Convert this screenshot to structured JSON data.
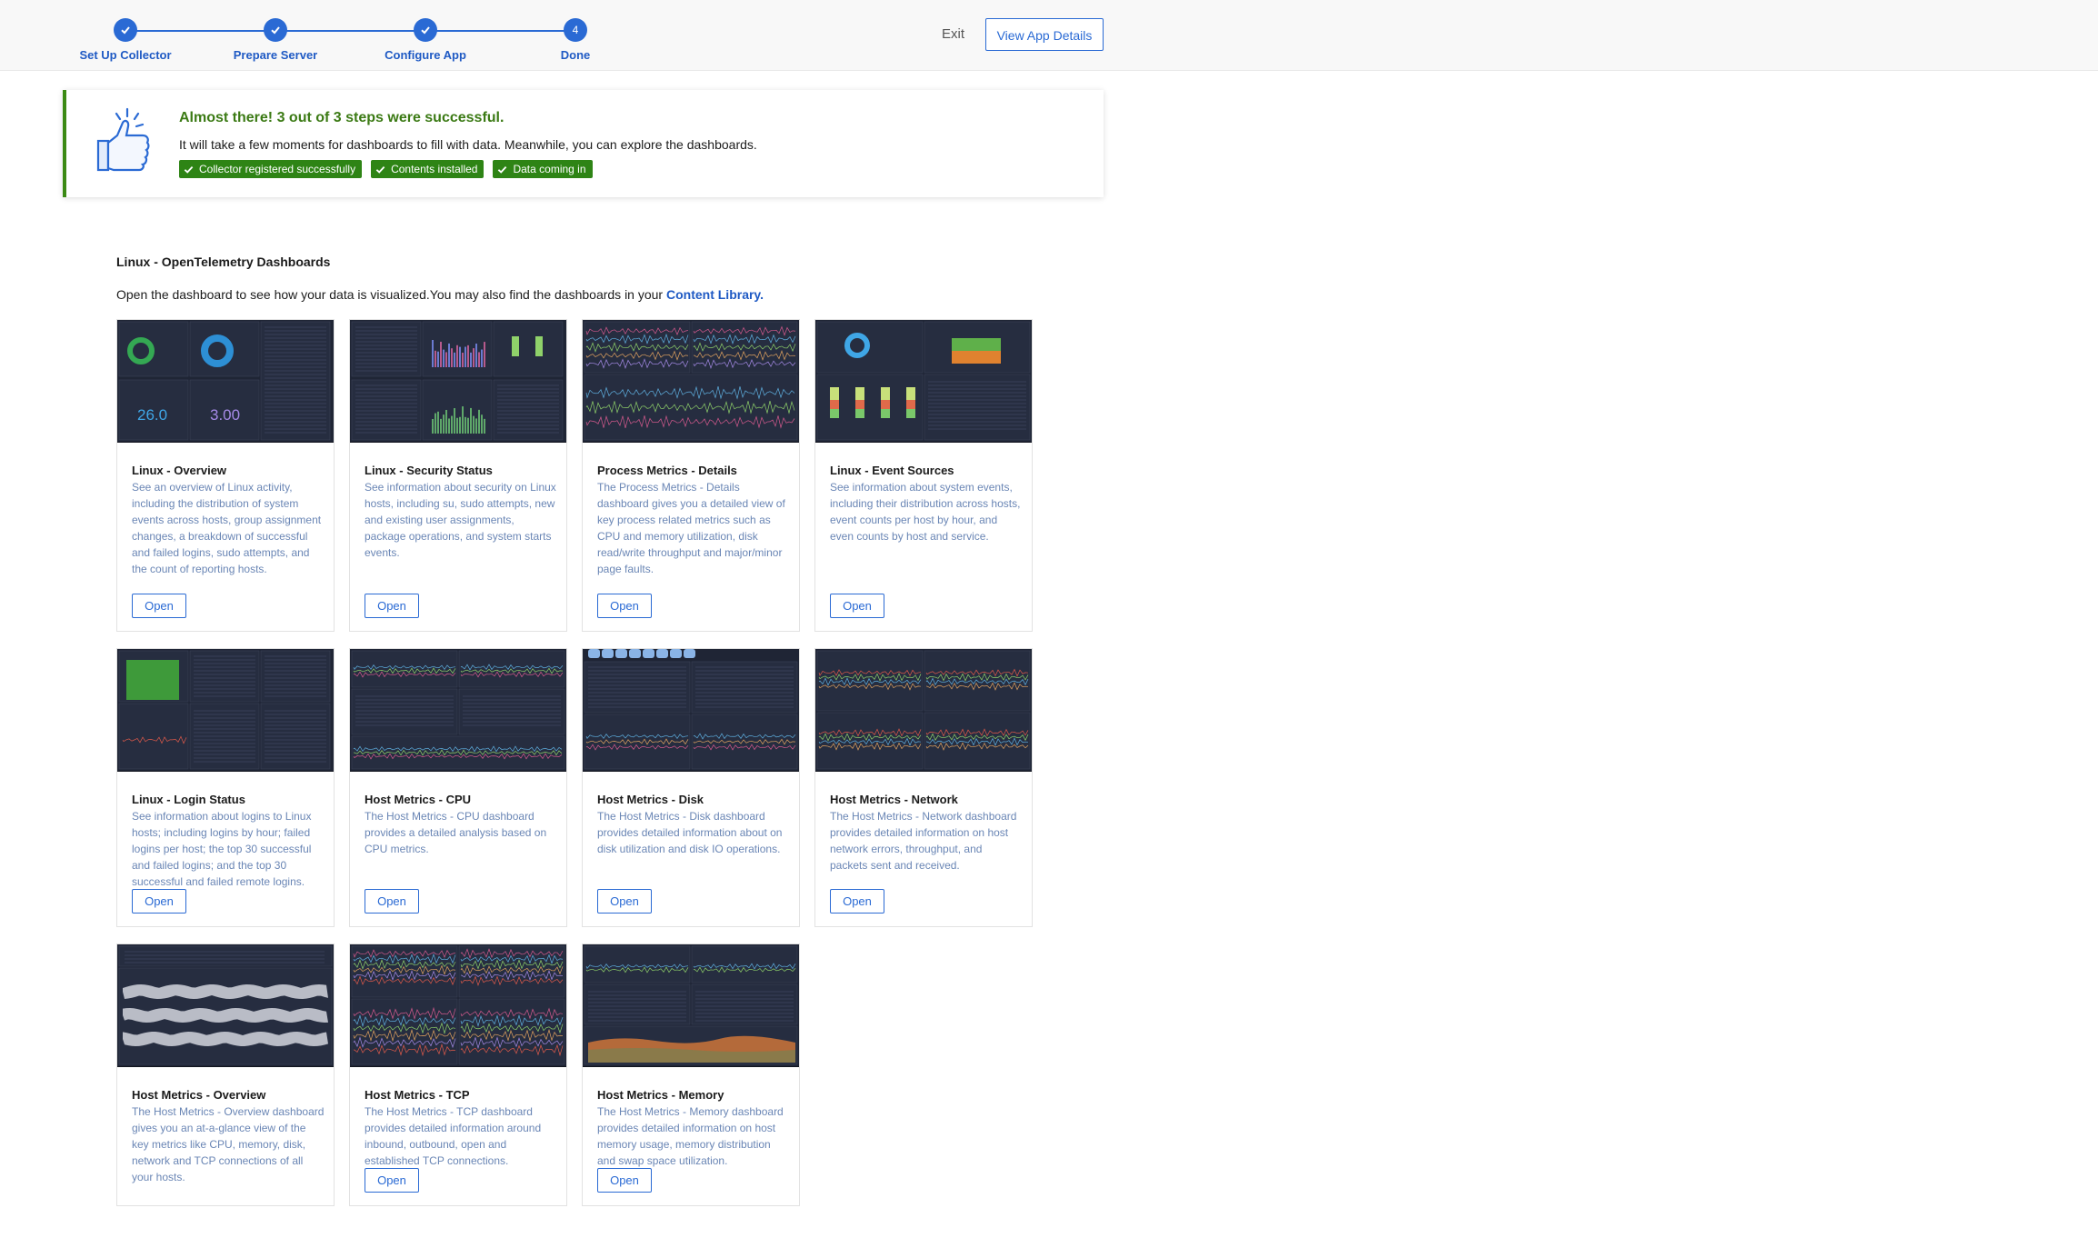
{
  "stepper": {
    "steps": [
      {
        "label": "Set Up Collector",
        "state": "complete"
      },
      {
        "label": "Prepare Server",
        "state": "complete"
      },
      {
        "label": "Configure App",
        "state": "complete"
      },
      {
        "label": "Done",
        "number": "4",
        "state": "current"
      }
    ]
  },
  "header": {
    "exit_label": "Exit",
    "view_app_label": "View App Details"
  },
  "banner": {
    "title": "Almost there! 3 out of 3 steps were successful.",
    "text": "It will take a few moments for dashboards to fill with data. Meanwhile, you can explore the dashboards.",
    "tags": [
      "Collector registered successfully",
      "Contents installed",
      "Data coming in"
    ],
    "icon": "thumbs-up-icon",
    "success_color": "#2e8415"
  },
  "section": {
    "title": "Linux - OpenTelemetry Dashboards",
    "desc_text": "Open the dashboard to see how your data is visualized.You may also find the dashboards in your ",
    "desc_link": "Content Library."
  },
  "accent_color": "#2a6ad4",
  "cards": [
    {
      "title": "Linux - Overview",
      "desc": "See an overview of Linux activity, including the distribution of system events across hosts, group assignment changes, a breakdown of successful and failed logins, sudo attempts, and the count of reporting hosts.",
      "open": "Open",
      "preview_values": [
        "26.0",
        "3.00"
      ]
    },
    {
      "title": "Linux - Security Status",
      "desc": "See information about security on Linux hosts, including su, sudo attempts, new and existing user assignments, package operations, and system starts events.",
      "open": "Open"
    },
    {
      "title": "Process Metrics - Details",
      "desc": "The Process Metrics - Details dashboard gives you a detailed view of key process related metrics such as CPU and memory utilization, disk read/write throughput and major/minor page faults.",
      "open": "Open"
    },
    {
      "title": "Linux - Event Sources",
      "desc": "See information about system events, including their distribution across hosts, event counts per host by hour, and even counts by host and service.",
      "open": "Open"
    },
    {
      "title": "Linux - Login Status",
      "desc": "See information about logins to Linux hosts; including logins by hour; failed logins per host; the top 30 successful and failed logins; and the top 30 successful and failed remote logins.",
      "open": "Open"
    },
    {
      "title": "Host Metrics - CPU",
      "desc": "The Host Metrics - CPU dashboard provides a detailed analysis based on CPU metrics.",
      "open": "Open"
    },
    {
      "title": "Host Metrics - Disk",
      "desc": "The Host Metrics - Disk dashboard provides detailed information about on disk utilization and disk IO operations.",
      "open": "Open"
    },
    {
      "title": "Host Metrics - Network",
      "desc": "The Host Metrics - Network dashboard provides detailed information on host network errors, throughput, and packets sent and received.",
      "open": "Open"
    },
    {
      "title": "Host Metrics - Overview",
      "desc": "The Host Metrics - Overview dashboard gives you an at-a-glance view of the key metrics like CPU, memory, disk, network and TCP connections of all your hosts.",
      "open": ""
    },
    {
      "title": "Host Metrics - TCP",
      "desc": "The Host Metrics - TCP dashboard provides detailed information around inbound, outbound, open and established TCP connections.",
      "open": "Open"
    },
    {
      "title": "Host Metrics - Memory",
      "desc": "The Host Metrics - Memory dashboard provides detailed information on host memory usage, memory distribution and swap space utilization.",
      "open": "Open"
    }
  ]
}
